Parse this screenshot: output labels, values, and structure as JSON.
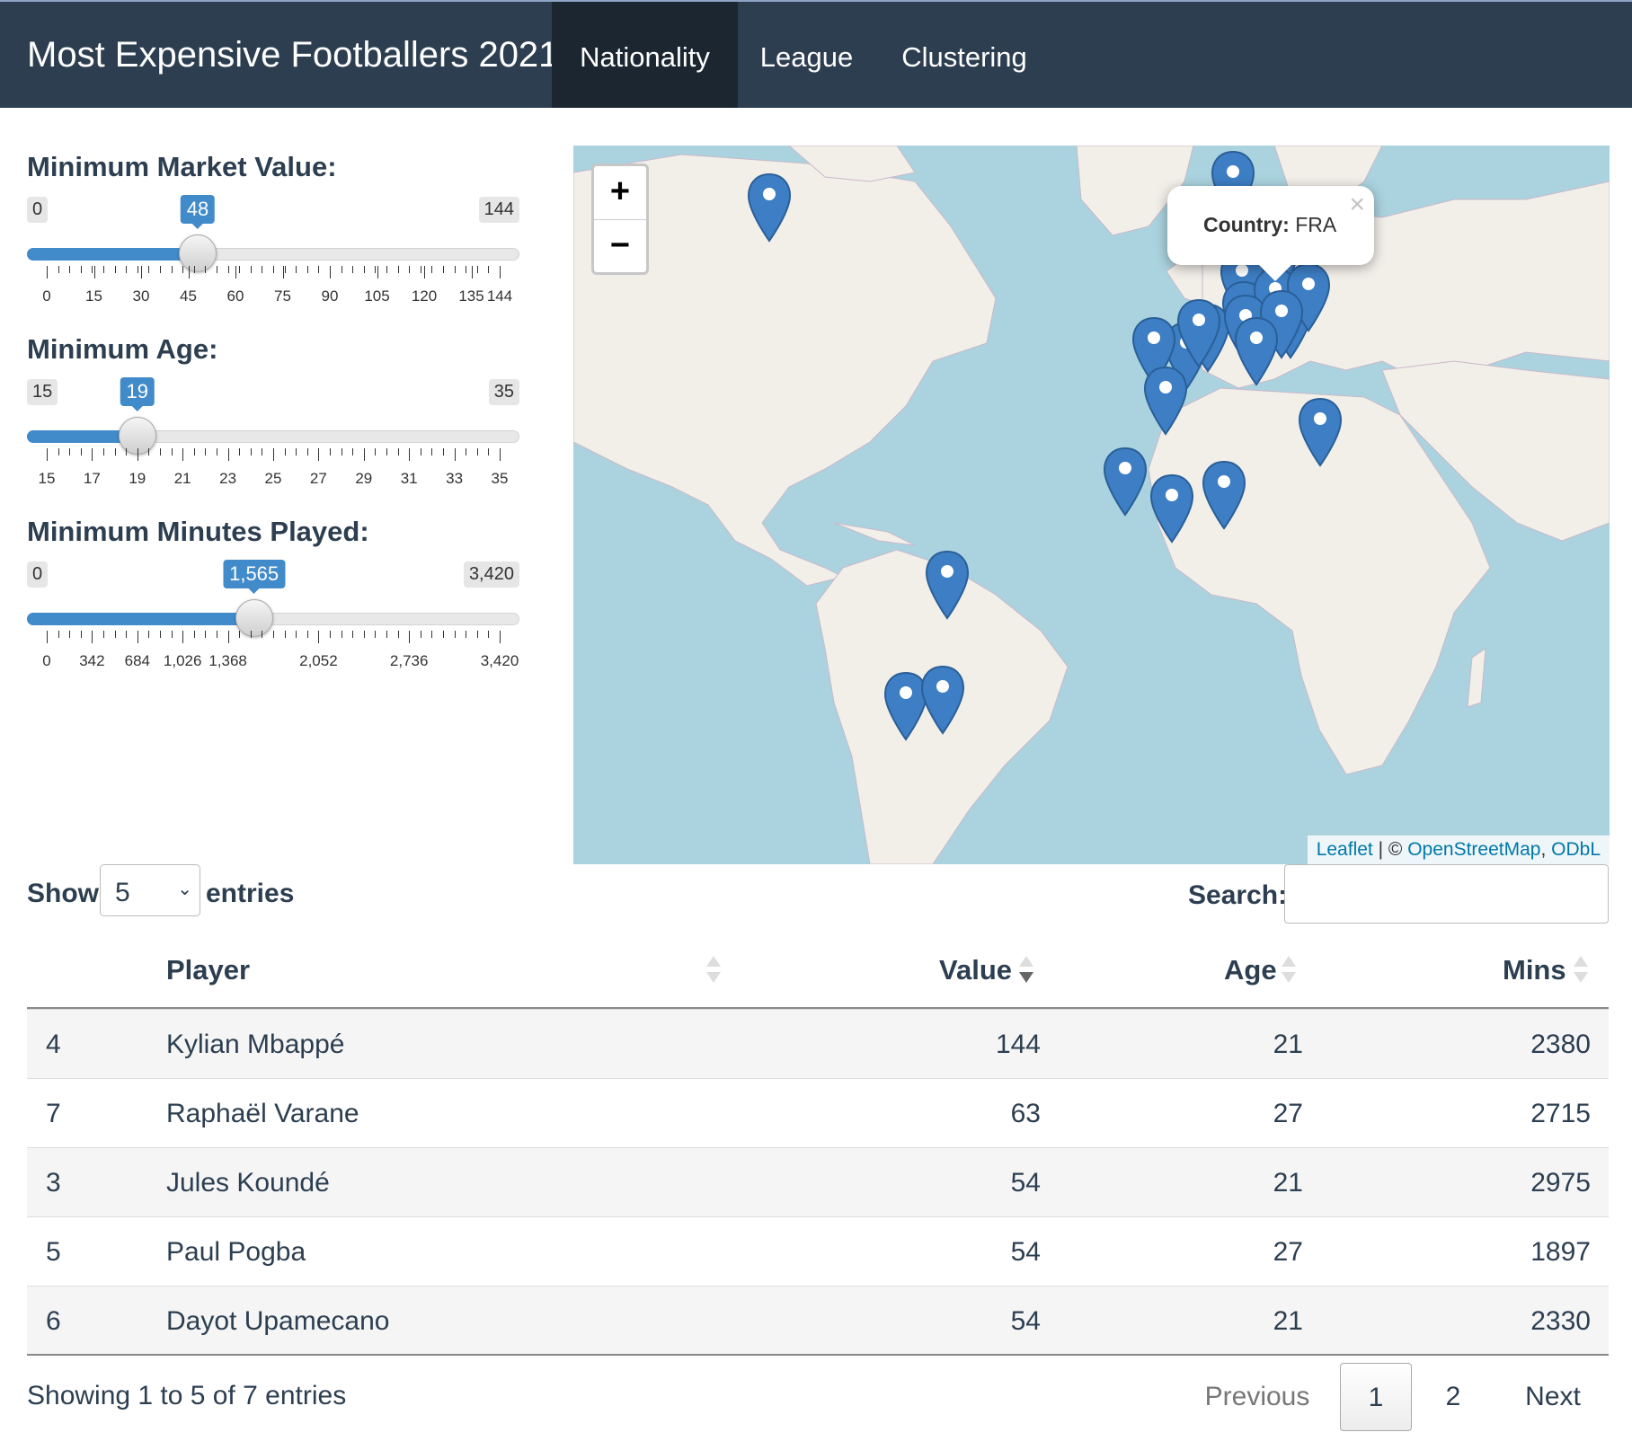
{
  "navbar": {
    "brand": "Most Expensive Footballers 2021",
    "tabs": [
      {
        "label": "Nationality",
        "active": true
      },
      {
        "label": "League",
        "active": false
      },
      {
        "label": "Clustering",
        "active": false
      }
    ]
  },
  "sliders": [
    {
      "label": "Minimum Market Value:",
      "min_label": "0",
      "max_label": "144",
      "value_label": "48",
      "min": 0,
      "max": 144,
      "value": 48,
      "ticks": [
        "0",
        "15",
        "30",
        "45",
        "60",
        "75",
        "90",
        "105",
        "120",
        "135",
        "144"
      ]
    },
    {
      "label": "Minimum Age:",
      "min_label": "15",
      "max_label": "35",
      "value_label": "19",
      "min": 15,
      "max": 35,
      "value": 19,
      "ticks": [
        "15",
        "17",
        "19",
        "21",
        "23",
        "25",
        "27",
        "29",
        "31",
        "33",
        "35"
      ]
    },
    {
      "label": "Minimum Minutes Played:",
      "min_label": "0",
      "max_label": "3,420",
      "value_label": "1,565",
      "min": 0,
      "max": 3420,
      "value": 1565,
      "ticks": [
        "0",
        "342",
        "684",
        "1,026",
        "1,368",
        "2,052",
        "2,736",
        "3,420"
      ]
    }
  ],
  "map": {
    "zoom_in": "+",
    "zoom_out": "−",
    "popup": {
      "key": "Country:",
      "value": "FRA",
      "close": "×"
    },
    "attribution": {
      "leaflet": "Leaflet",
      "sep": " | © ",
      "osm": "OpenStreetMap",
      "comma": ", ",
      "odbl": "ODbL"
    },
    "marker_color": "#3d7ec4"
  },
  "table_controls": {
    "show_label": "Show",
    "entries_value": "5",
    "entries_label": "entries",
    "search_label": "Search:",
    "search_value": ""
  },
  "table": {
    "columns": [
      "",
      "Player",
      "Value",
      "Age",
      "Mins"
    ],
    "sorted_column": "Value",
    "rows": [
      {
        "idx": "4",
        "player": "Kylian Mbappé",
        "value": "144",
        "age": "21",
        "mins": "2380"
      },
      {
        "idx": "7",
        "player": "Raphaël Varane",
        "value": "63",
        "age": "27",
        "mins": "2715"
      },
      {
        "idx": "3",
        "player": "Jules Koundé",
        "value": "54",
        "age": "21",
        "mins": "2975"
      },
      {
        "idx": "5",
        "player": "Paul Pogba",
        "value": "54",
        "age": "27",
        "mins": "1897"
      },
      {
        "idx": "6",
        "player": "Dayot Upamecano",
        "value": "54",
        "age": "21",
        "mins": "2330"
      }
    ]
  },
  "footer": {
    "info": "Showing 1 to 5 of 7 entries",
    "previous": "Previous",
    "pages": [
      "1",
      "2"
    ],
    "current_page": "1",
    "next": "Next"
  },
  "colors": {
    "navbar": "#2c3e50",
    "accent": "#428bca",
    "water": "#aad3df",
    "land": "#f2efe9"
  }
}
